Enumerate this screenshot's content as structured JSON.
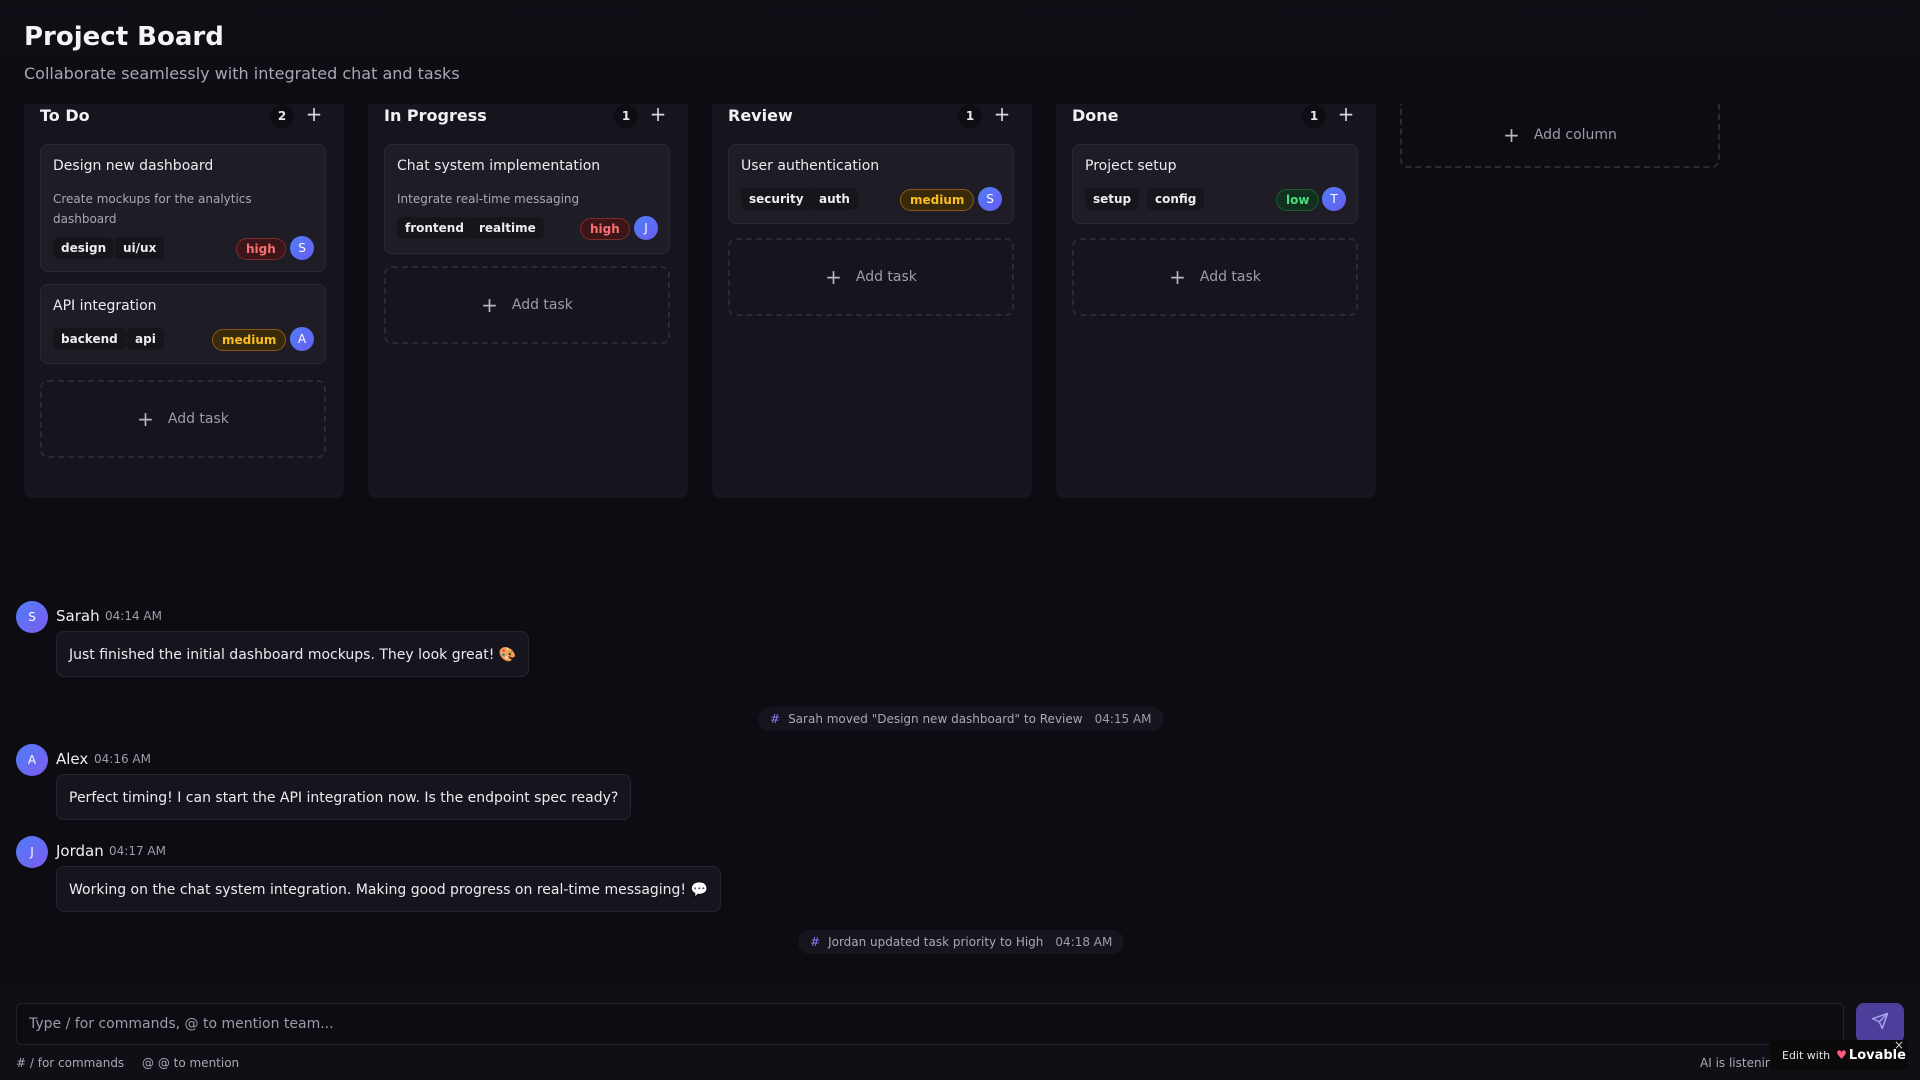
{
  "header": {
    "title": "Project Board",
    "subtitle": "Collaborate seamlessly with integrated chat and tasks"
  },
  "columns": [
    {
      "title": "To Do",
      "count": "2",
      "add_icon": "+",
      "tasks": [
        {
          "title": "Design new dashboard",
          "description": "Create mockups for the analytics dashboard",
          "tags": [
            "design",
            "ui/ux"
          ],
          "priority": "high",
          "assignee": "S"
        },
        {
          "title": "API integration",
          "description": "",
          "tags": [
            "backend",
            "api"
          ],
          "priority": "medium",
          "assignee": "A"
        }
      ],
      "add_task_label": "Add task"
    },
    {
      "title": "In Progress",
      "count": "1",
      "add_icon": "+",
      "tasks": [
        {
          "title": "Chat system implementation",
          "description": "Integrate real-time messaging",
          "tags": [
            "frontend",
            "realtime"
          ],
          "priority": "high",
          "assignee": "J"
        }
      ],
      "add_task_label": "Add task"
    },
    {
      "title": "Review",
      "count": "1",
      "add_icon": "+",
      "tasks": [
        {
          "title": "User authentication",
          "description": "",
          "tags": [
            "security",
            "auth"
          ],
          "priority": "medium",
          "assignee": "S"
        }
      ],
      "add_task_label": "Add task"
    },
    {
      "title": "Done",
      "count": "1",
      "add_icon": "+",
      "tasks": [
        {
          "title": "Project setup",
          "description": "",
          "tags": [
            "setup",
            "config"
          ],
          "priority": "low",
          "assignee": "T"
        }
      ],
      "add_task_label": "Add task"
    }
  ],
  "add_column_label": "Add column",
  "plus_glyph": "+",
  "chat": {
    "messages": [
      {
        "type": "user",
        "avatar": "S",
        "name": "Sarah",
        "time": "04:14 AM",
        "text": "Just finished the initial dashboard mockups. They look great! 🎨"
      },
      {
        "type": "system",
        "text": "Sarah moved \"Design new dashboard\" to Review",
        "time": "04:15 AM"
      },
      {
        "type": "user",
        "avatar": "A",
        "name": "Alex",
        "time": "04:16 AM",
        "text": "Perfect timing! I can start the API integration now. Is the endpoint spec ready?"
      },
      {
        "type": "user",
        "avatar": "J",
        "name": "Jordan",
        "time": "04:17 AM",
        "text": "Working on the chat system integration. Making good progress on real-time messaging! 💬"
      },
      {
        "type": "system",
        "text": "Jordan updated task priority to High",
        "time": "04:18 AM"
      }
    ],
    "system_icon": "#"
  },
  "composer": {
    "placeholder": "Type / for commands, @ to mention team...",
    "hint_commands": "# / for commands",
    "hint_mention": "@ @ to mention",
    "ai_status": "AI is listenin",
    "send_icon": "send-icon"
  },
  "badge": {
    "prefix": "Edit with",
    "heart": "♥",
    "brand": "Lovable",
    "close": "×"
  },
  "colors": {
    "background": "#0d0c12",
    "column_bg": "#16151d",
    "card_bg": "#1e1d25",
    "accent": "#4c3f9b",
    "priority_high": "#f87171",
    "priority_medium": "#fbbf24",
    "priority_low": "#4ade80",
    "avatar": "#4f7ef7"
  }
}
